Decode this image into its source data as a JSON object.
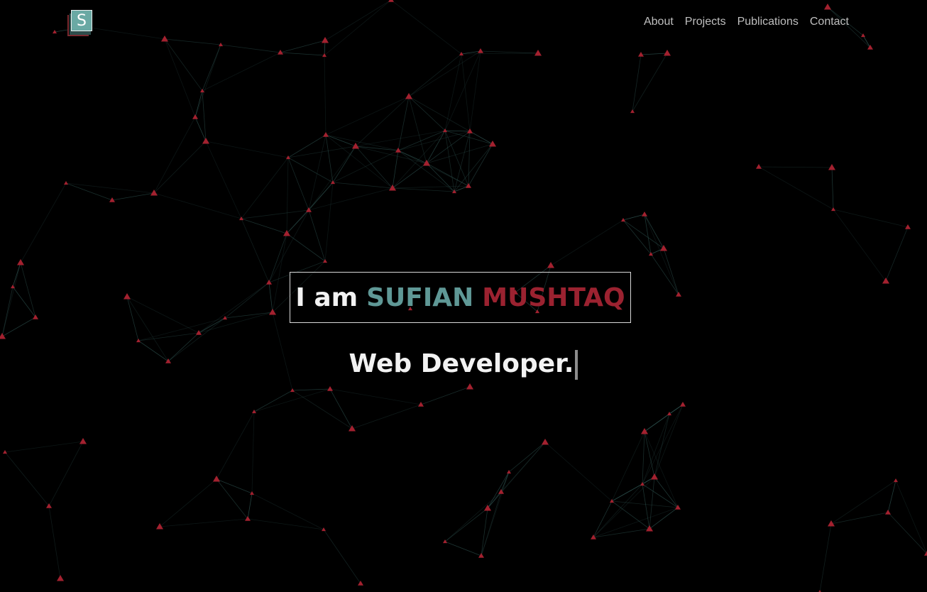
{
  "logo": {
    "letter": "S"
  },
  "nav": {
    "items": [
      {
        "label": "About"
      },
      {
        "label": "Projects"
      },
      {
        "label": "Publications"
      },
      {
        "label": "Contact"
      }
    ]
  },
  "hero": {
    "prefix": "I am",
    "first_name": "SUFIAN",
    "last_name": "MUSHTAQ",
    "role": "Web Developer."
  },
  "colors": {
    "background": "#000000",
    "accent_teal": "#5f9896",
    "accent_red": "#9b2230",
    "line": "#2f5552",
    "node": "#a3212f"
  }
}
